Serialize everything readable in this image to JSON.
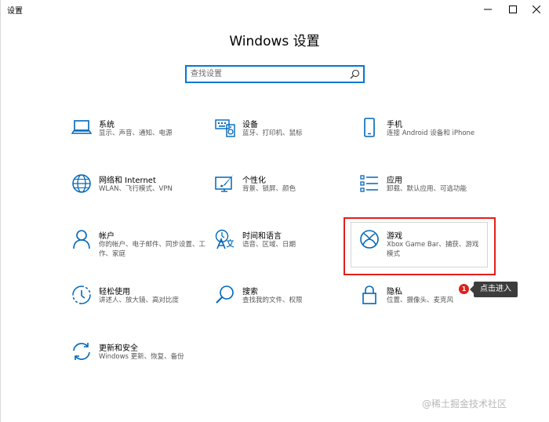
{
  "window": {
    "app_title": "设置",
    "controls": {
      "minimize": "minimize",
      "maximize": "maximize",
      "close": "close"
    }
  },
  "header": {
    "title": "Windows 设置"
  },
  "search": {
    "placeholder": "查找设置",
    "icon": "search-icon"
  },
  "tiles": [
    {
      "title": "系统",
      "desc": "显示、声音、通知、电源",
      "icon": "laptop-icon"
    },
    {
      "title": "设备",
      "desc": "蓝牙、打印机、鼠标",
      "icon": "keyboard-speaker-icon"
    },
    {
      "title": "手机",
      "desc": "连接 Android 设备和 iPhone",
      "icon": "phone-icon"
    },
    {
      "title": "网络和 Internet",
      "desc": "WLAN、飞行模式、VPN",
      "icon": "globe-icon"
    },
    {
      "title": "个性化",
      "desc": "背景、锁屏、颜色",
      "icon": "paint-screen-icon"
    },
    {
      "title": "应用",
      "desc": "卸载、默认应用、可选功能",
      "icon": "app-list-icon"
    },
    {
      "title": "帐户",
      "desc": "你的帐户、电子邮件、同步设置、工作、家庭",
      "icon": "person-icon"
    },
    {
      "title": "时间和语言",
      "desc": "语音、区域、日期",
      "icon": "time-language-icon"
    },
    {
      "title": "游戏",
      "desc": "Xbox Game Bar、捕获、游戏模式",
      "icon": "xbox-icon"
    },
    {
      "title": "轻松使用",
      "desc": "讲述人、放大镜、高对比度",
      "icon": "ease-of-access-icon"
    },
    {
      "title": "搜索",
      "desc": "查找我的文件、权限",
      "icon": "magnifier-icon"
    },
    {
      "title": "隐私",
      "desc": "位置、摄像头、麦克风",
      "icon": "lock-icon"
    },
    {
      "title": "更新和安全",
      "desc": "Windows 更新、恢复、备份",
      "icon": "sync-icon"
    }
  ],
  "annotation": {
    "badge": "1",
    "tooltip": "点击进入"
  },
  "watermark": "@稀土掘金技术社区",
  "colors": {
    "accent": "#0078d7",
    "highlight": "#e0201b"
  }
}
